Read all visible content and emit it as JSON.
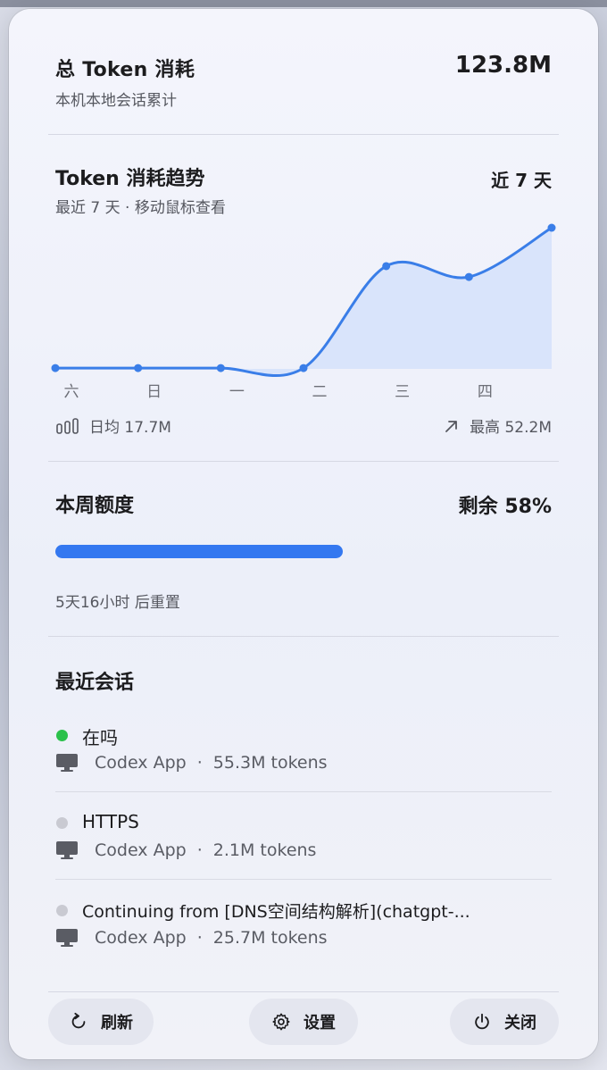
{
  "total": {
    "title": "总 Token 消耗",
    "subtitle": "本机本地会话累计",
    "value": "123.8M"
  },
  "trend": {
    "title": "Token 消耗趋势",
    "subtitle": "最近 7 天 · 移动鼠标查看",
    "range_label": "近 7 天",
    "avg_label": "日均 17.7M",
    "max_label": "最高 52.2M"
  },
  "chart_data": {
    "type": "area",
    "x": [
      "六",
      "日",
      "一",
      "二",
      "三",
      "四",
      ""
    ],
    "values": [
      0.3,
      0.3,
      0.3,
      0.3,
      38.0,
      34.0,
      52.2
    ],
    "ylim": [
      0,
      52.2
    ],
    "grid": false,
    "line_color": "#3a7ee8",
    "fill_color": "#d9e4fb"
  },
  "quota": {
    "title": "本周额度",
    "remaining_label": "剩余 58%",
    "remaining_fraction": 0.58,
    "reset_text": "5天16小时 后重置",
    "bar_color": "#3478f0"
  },
  "sessions": {
    "title": "最近会话",
    "items": [
      {
        "title": "在吗",
        "source": "Codex App",
        "tokens": "55.3M tokens",
        "status_color": "#2bc14b"
      },
      {
        "title": "HTTPS",
        "source": "Codex App",
        "tokens": "2.1M tokens",
        "status_color": "#c9cad2"
      },
      {
        "title": "Continuing from [DNS空间结构解析](chatgpt-...",
        "source": "Codex App",
        "tokens": "25.7M tokens",
        "status_color": "#c9cad2"
      }
    ],
    "separator": "·"
  },
  "footer": {
    "refresh_label": "刷新",
    "settings_label": "设置",
    "close_label": "关闭"
  }
}
